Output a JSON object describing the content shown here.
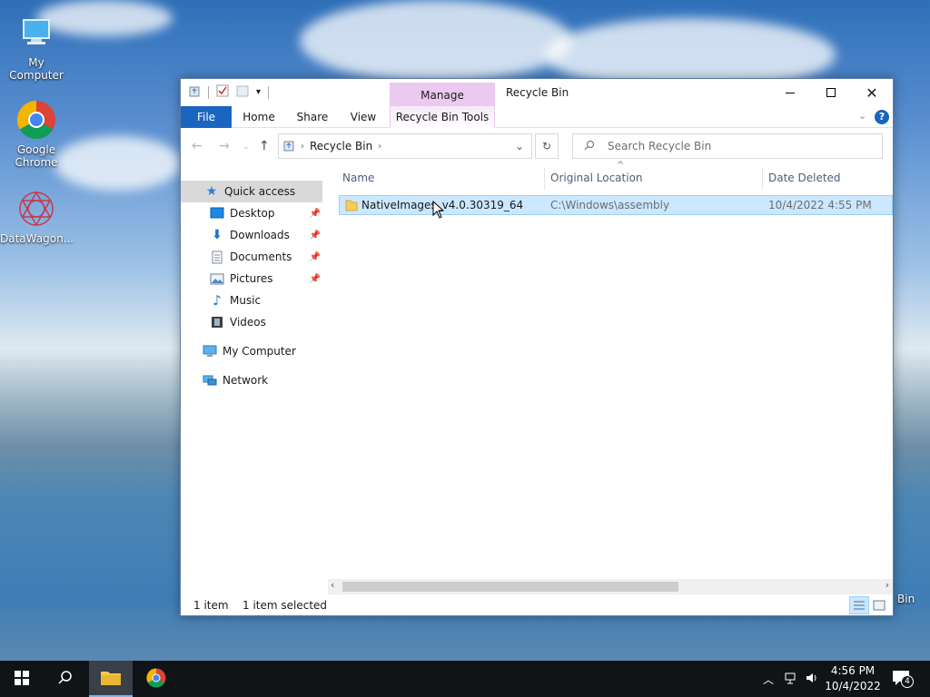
{
  "desktop": {
    "icons": [
      {
        "label": "My Computer"
      },
      {
        "label": "Google Chrome"
      },
      {
        "label": "DataWagon..."
      }
    ],
    "partial_label": "Bin"
  },
  "window": {
    "title": "Recycle Bin",
    "manage_tab": "Manage",
    "ribbon_tabs": {
      "file": "File",
      "home": "Home",
      "share": "Share",
      "view": "View",
      "tools": "Recycle Bin Tools"
    },
    "address": {
      "segment": "Recycle Bin"
    },
    "search": {
      "placeholder": "Search Recycle Bin"
    },
    "nav": {
      "quick_access": "Quick access",
      "desktop": "Desktop",
      "downloads": "Downloads",
      "documents": "Documents",
      "pictures": "Pictures",
      "music": "Music",
      "videos": "Videos",
      "my_computer": "My Computer",
      "network": "Network"
    },
    "columns": {
      "name": "Name",
      "location": "Original Location",
      "date": "Date Deleted"
    },
    "rows": [
      {
        "name": "NativeImages_v4.0.30319_64",
        "location": "C:\\Windows\\assembly",
        "date": "10/4/2022 4:55 PM"
      }
    ],
    "status": {
      "count": "1 item",
      "selected": "1 item selected"
    }
  },
  "taskbar": {
    "time": "4:56 PM",
    "date": "10/4/2022",
    "notification_count": "4"
  },
  "colors": {
    "accent": "#1a65c0",
    "manage_tab": "#ecc9f1",
    "selection": "#cce8ff",
    "taskbar": "#101417"
  }
}
